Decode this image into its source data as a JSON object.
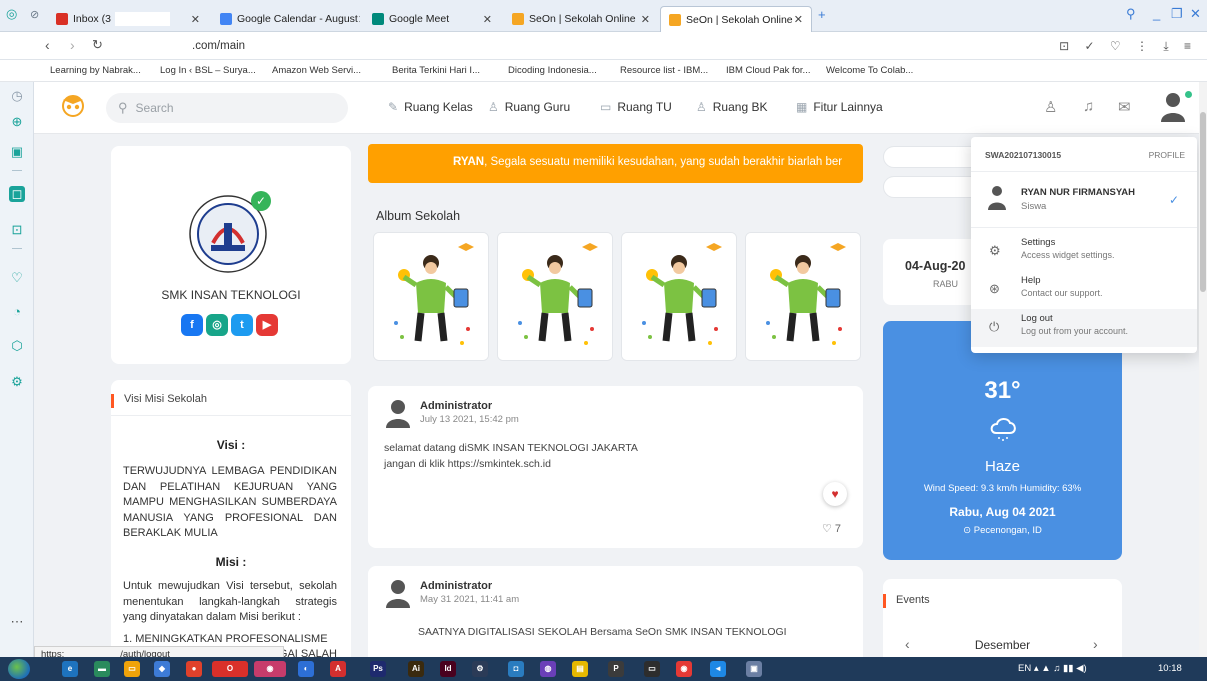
{
  "browser": {
    "tabs": [
      {
        "label": "Inbox (3",
        "fav_color": "#d93025"
      },
      {
        "label": "Google Calendar - August",
        "fav_color": "#4285f4"
      },
      {
        "label": "Google Meet",
        "fav_color": "#00897b"
      },
      {
        "label": "SeOn | Sekolah Online",
        "fav_color": "#f5a623"
      },
      {
        "label": "SeOn | Sekolah Online",
        "fav_color": "#f5a623"
      }
    ],
    "new_tab": "+",
    "url_visible": ".com/main",
    "bookmarks": [
      "Learning by Nabrak...",
      "Log In ‹ BSL – Surya...",
      "Amazon Web Servi...",
      "Berita Terkini Hari I...",
      "Dicoding Indonesia...",
      "Resource list - IBM...",
      "IBM Cloud Pak for...",
      "Welcome To Colab..."
    ],
    "status_url_prefix": "https:",
    "status_url_path": "/auth/logout"
  },
  "nav": {
    "search_placeholder": "Search",
    "menu": [
      {
        "label": "Ruang Kelas",
        "icon": "pencil-icon"
      },
      {
        "label": "Ruang Guru",
        "icon": "user-icon"
      },
      {
        "label": "Ruang TU",
        "icon": "folder-icon"
      },
      {
        "label": "Ruang BK",
        "icon": "users-icon"
      },
      {
        "label": "Fitur Lainnya",
        "icon": "grid-icon"
      }
    ]
  },
  "school": {
    "name": "SMK INSAN TEKNOLOGI",
    "social": [
      {
        "name": "facebook",
        "glyph": "f",
        "color": "#1877f2"
      },
      {
        "name": "instagram",
        "glyph": "◎",
        "color": "#17a589"
      },
      {
        "name": "twitter",
        "glyph": "t",
        "color": "#1d9bf0"
      },
      {
        "name": "youtube",
        "glyph": "▶",
        "color": "#e53935"
      }
    ]
  },
  "visi_misi": {
    "title": "Visi Misi Sekolah",
    "visi_heading": "Visi :",
    "visi_text": "TERWUJUDNYA LEMBAGA PENDIDIKAN DAN PELATIHAN KEJURUAN YANG MAMPU MENGHASILKAN SUMBERDAYA MANUSIA YANG PROFESIONAL DAN BERAKLAK MULIA",
    "misi_heading": "Misi :",
    "misi_text": "Untuk mewujudkan Visi tersebut, sekolah menentukan langkah-langkah strategis yang dinyatakan dalam Misi berikut :",
    "misi_item": "1. MENINGKATKAN PROFESONALISME",
    "misi_item2": "ABILITAS SEBAGAI SALAH"
  },
  "announcement": {
    "name": "RYAN",
    "text": ", Segala sesuatu memiliki kesudahan, yang sudah berakhir biarlah ber"
  },
  "album": {
    "title": "Album Sekolah",
    "count": 4
  },
  "posts": [
    {
      "author": "Administrator",
      "date": "July 13 2021, 15:42 pm",
      "line1": "selamat datang diSMK INSAN TEKNOLOGI JAKARTA",
      "line2": "jangan di klik https://smkintek.sch.id",
      "likes": "7"
    },
    {
      "author": "Administrator",
      "date": "May 31 2021, 11:41 am",
      "line1": "SAATNYA DIGITALISASI  SEKOLAH Bersama SeOn SMK INSAN TEKNOLOGI"
    }
  ],
  "date_widget": {
    "date": "04-Aug-20",
    "day": "RABU"
  },
  "weather": {
    "temp": "31°",
    "condition": "Haze",
    "detail": "Wind Speed: 9.3 km/h    Humidity: 63%",
    "date": "Rabu, Aug 04 2021",
    "location": "Pecenongan, ID",
    "bg_color": "#4a90e2"
  },
  "events": {
    "title": "Events",
    "month": "Desember",
    "prev": "‹",
    "next": "›"
  },
  "dropdown": {
    "user_id": "SWA202107130015",
    "profile_label": "PROFILE",
    "name": "RYAN NUR FIRMANSYAH",
    "role": "Siswa",
    "items": [
      {
        "title": "Settings",
        "sub": "Access widget settings.",
        "icon": "gear-icon"
      },
      {
        "title": "Help",
        "sub": "Contact our support.",
        "icon": "lifebuoy-icon"
      },
      {
        "title": "Log out",
        "sub": "Log out from your account.",
        "icon": "power-icon"
      }
    ]
  },
  "taskbar": {
    "tray_text": "EN",
    "clock": "10:18"
  }
}
